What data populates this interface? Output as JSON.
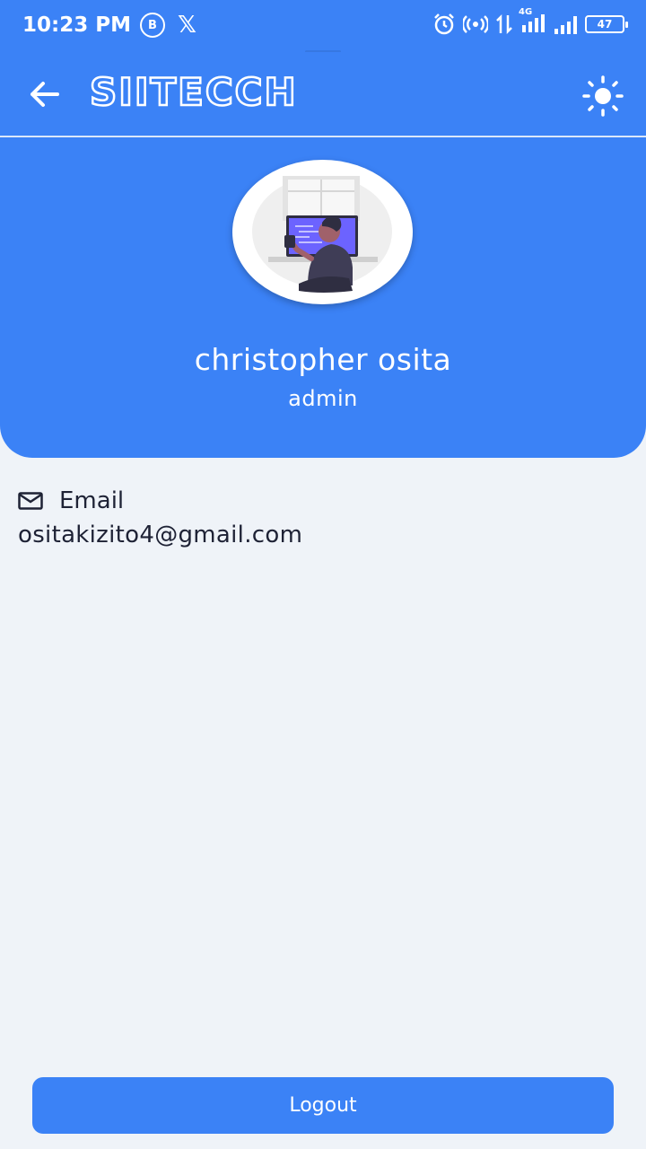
{
  "status_bar": {
    "time": "10:23 PM",
    "b_badge": "B",
    "x_badge": "𝕏",
    "network_label": "4G",
    "battery": "47"
  },
  "app_bar": {
    "title": "SIITECCH"
  },
  "profile": {
    "name": "christopher osita",
    "role": "admin"
  },
  "email": {
    "label": "Email",
    "value": "ositakizito4@gmail.com"
  },
  "actions": {
    "logout_label": "Logout"
  },
  "colors": {
    "primary": "#3b82f6",
    "background": "#eff3f8",
    "text": "#1e2235"
  }
}
